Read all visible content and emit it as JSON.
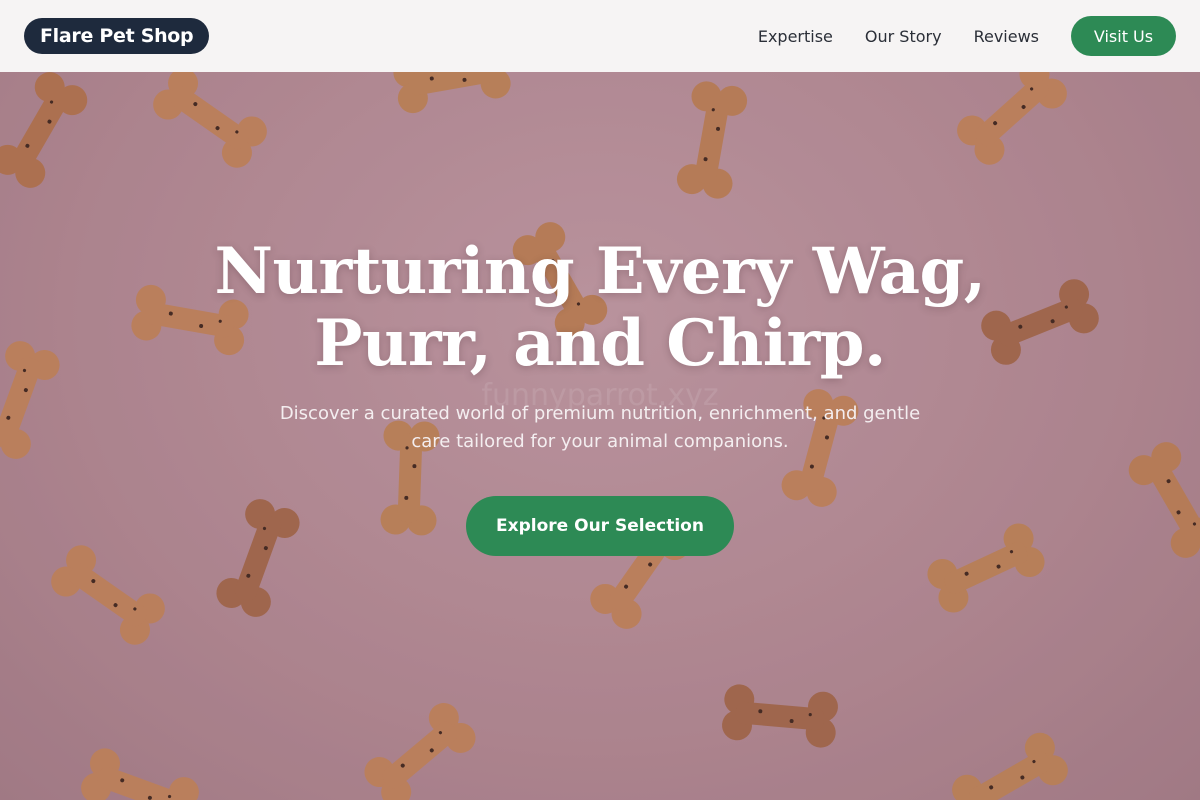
{
  "brand": {
    "name": "Flare Pet Shop"
  },
  "nav": {
    "links": [
      {
        "label": "Expertise"
      },
      {
        "label": "Our Story"
      },
      {
        "label": "Reviews"
      }
    ],
    "cta_label": "Visit Us"
  },
  "hero": {
    "headline": "Nurturing Every Wag, Purr, and Chirp.",
    "subheadline": "Discover a curated world of premium nutrition, enrichment, and gentle care tailored for your animal companions.",
    "cta_label": "Explore Our Selection",
    "background_image": "dog-treat-bones-on-pink",
    "watermark": "funnyparrot.xyz"
  },
  "colors": {
    "brand_dark": "#1e2a3d",
    "accent_green": "#2d8a55",
    "nav_bg": "#f6f4f4",
    "hero_pink": "#b8909a"
  }
}
